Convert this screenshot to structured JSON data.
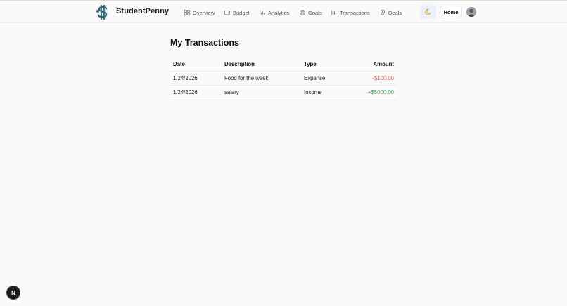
{
  "header": {
    "brand": "StudentPenny",
    "nav": [
      {
        "label": "Overview",
        "icon": "overview-grid-icon"
      },
      {
        "label": "Budget",
        "icon": "wallet-icon"
      },
      {
        "label": "Analytics",
        "icon": "bar-chart-icon"
      },
      {
        "label": "Goals",
        "icon": "target-icon"
      },
      {
        "label": "Transactions",
        "icon": "chart-icon"
      },
      {
        "label": "Deals",
        "icon": "map-pin-icon"
      }
    ],
    "theme_toggle_icon": "moon-icon",
    "home_label": "Home"
  },
  "main": {
    "title": "My Transactions",
    "table": {
      "headers": [
        "Date",
        "Description",
        "Type",
        "Amount"
      ],
      "rows": [
        {
          "date": "1/24/2026",
          "description": "Food for the week",
          "type": "Expense",
          "amount": "-$100.00"
        },
        {
          "date": "1/24/2026",
          "description": "salary",
          "type": "Income",
          "amount": "+$5000.00"
        }
      ]
    }
  },
  "dev_badge": "N",
  "colors": {
    "expense": "#e0564f",
    "income": "#3ea84e",
    "brand_teal": "#2f6b73"
  }
}
